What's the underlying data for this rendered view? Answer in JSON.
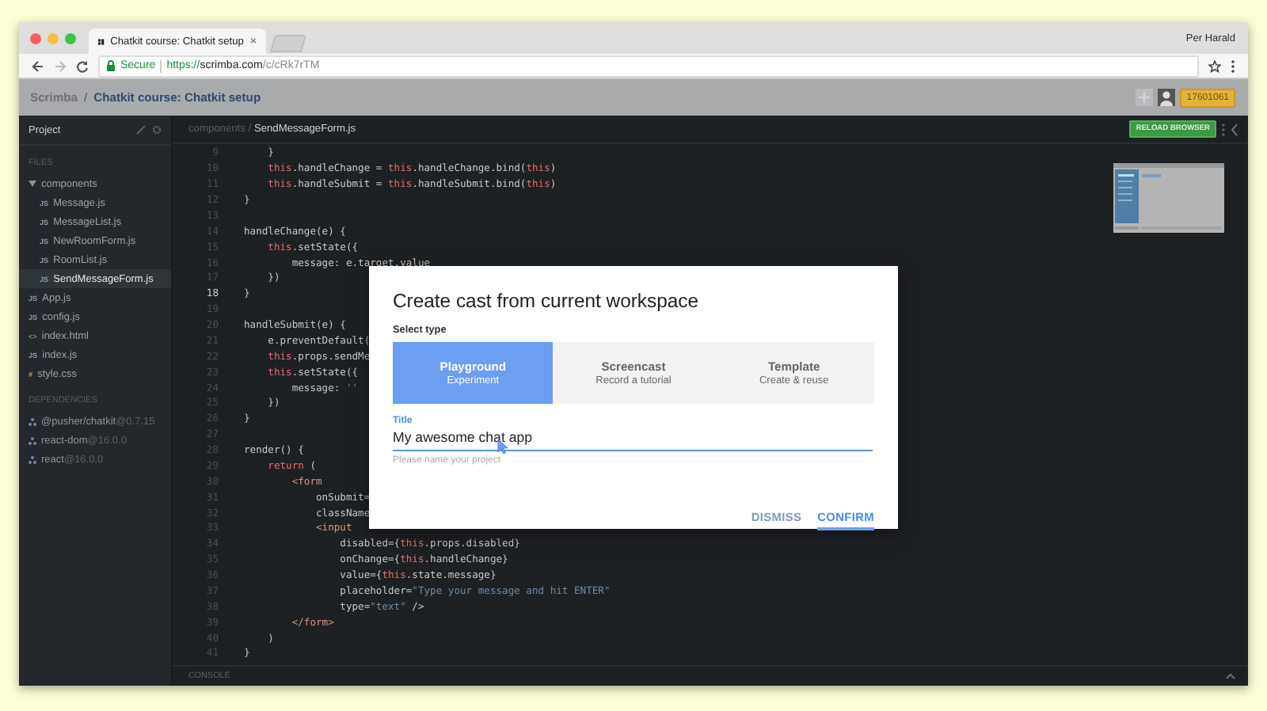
{
  "browser": {
    "tab": {
      "title": "Chatkit course: Chatkit setup",
      "close": "×"
    },
    "user": "Per Harald",
    "security": "Secure",
    "url": {
      "scheme": "https://",
      "host": "scrimba.com",
      "path": "/c/cRk7rTM"
    }
  },
  "header": {
    "brand": "Scrimba",
    "separator": "/",
    "course": "Chatkit course: Chatkit setup",
    "counter": "17601061"
  },
  "sidebar": {
    "title": "Project",
    "files_heading": "FILES",
    "files": [
      {
        "name": "components",
        "kind": "folder",
        "expanded": true,
        "selected": false,
        "children": [
          {
            "name": "Message.js",
            "kind": "js",
            "badge": "JS",
            "selected": false
          },
          {
            "name": "MessageList.js",
            "kind": "js",
            "badge": "JS",
            "selected": false
          },
          {
            "name": "NewRoomForm.js",
            "kind": "js",
            "badge": "JS",
            "selected": false
          },
          {
            "name": "RoomList.js",
            "kind": "js",
            "badge": "JS",
            "selected": false
          },
          {
            "name": "SendMessageForm.js",
            "kind": "js",
            "badge": "JS",
            "selected": true
          }
        ]
      },
      {
        "name": "App.js",
        "kind": "js",
        "badge": "JS",
        "selected": false
      },
      {
        "name": "config.js",
        "kind": "js",
        "badge": "JS",
        "selected": false
      },
      {
        "name": "index.html",
        "kind": "html",
        "badge": "<>",
        "selected": false
      },
      {
        "name": "index.js",
        "kind": "js",
        "badge": "JS",
        "selected": false
      },
      {
        "name": "style.css",
        "kind": "css",
        "badge": "#",
        "selected": false
      }
    ],
    "dependencies_heading": "DEPENDENCIES",
    "dependencies": [
      {
        "name": "@pusher/chatkit",
        "version": "@0.7.15"
      },
      {
        "name": "react-dom",
        "version": "@16.0.0"
      },
      {
        "name": "react",
        "version": "@16.0.0"
      }
    ]
  },
  "editor": {
    "path": {
      "folder": "components",
      "separator": "/",
      "file": "SendMessageForm.js"
    },
    "reload": "RELOAD BROWSER",
    "console": "CONSOLE",
    "lines": [
      {
        "number": "9",
        "current": false,
        "tokens": [
          {
            "text": "    }",
            "kind": "plain"
          }
        ]
      },
      {
        "number": "10",
        "current": false,
        "tokens": [
          {
            "text": "    this",
            "kind": "keyword"
          },
          {
            "text": ".handleChange = ",
            "kind": "plain"
          },
          {
            "text": "this",
            "kind": "keyword"
          },
          {
            "text": ".handleChange.bind(",
            "kind": "plain"
          },
          {
            "text": "this",
            "kind": "keyword"
          },
          {
            "text": ")",
            "kind": "plain"
          }
        ]
      },
      {
        "number": "11",
        "current": false,
        "tokens": [
          {
            "text": "    this",
            "kind": "keyword"
          },
          {
            "text": ".handleSubmit = ",
            "kind": "plain"
          },
          {
            "text": "this",
            "kind": "keyword"
          },
          {
            "text": ".handleSubmit.bind(",
            "kind": "plain"
          },
          {
            "text": "this",
            "kind": "keyword"
          },
          {
            "text": ")",
            "kind": "plain"
          }
        ]
      },
      {
        "number": "12",
        "current": false,
        "tokens": [
          {
            "text": "}",
            "kind": "plain"
          }
        ]
      },
      {
        "number": "13",
        "current": false
      },
      {
        "number": "14",
        "current": false,
        "tokens": [
          {
            "text": "handleChange(e) {",
            "kind": "plain"
          }
        ]
      },
      {
        "number": "15",
        "current": false,
        "tokens": [
          {
            "text": "    this",
            "kind": "keyword"
          },
          {
            "text": ".setState({",
            "kind": "plain"
          }
        ]
      },
      {
        "number": "16",
        "current": false,
        "tokens": [
          {
            "text": "        message: e.target.value",
            "kind": "plain"
          }
        ]
      },
      {
        "number": "17",
        "current": false,
        "tokens": [
          {
            "text": "    })",
            "kind": "plain"
          }
        ]
      },
      {
        "number": "18",
        "current": true,
        "tokens": [
          {
            "text": "}",
            "kind": "plain"
          }
        ]
      },
      {
        "number": "19",
        "current": false
      },
      {
        "number": "20",
        "current": false,
        "tokens": [
          {
            "text": "handleSubmit(e) {",
            "kind": "plain"
          }
        ]
      },
      {
        "number": "21",
        "current": false,
        "tokens": [
          {
            "text": "    e.preventDefault(",
            "kind": "plain"
          }
        ]
      },
      {
        "number": "22",
        "current": false,
        "tokens": [
          {
            "text": "    this",
            "kind": "keyword"
          },
          {
            "text": ".props.sendMe",
            "kind": "plain"
          }
        ]
      },
      {
        "number": "23",
        "current": false,
        "tokens": [
          {
            "text": "    this",
            "kind": "keyword"
          },
          {
            "text": ".setState({",
            "kind": "plain"
          }
        ]
      },
      {
        "number": "24",
        "current": false,
        "tokens": [
          {
            "text": "        message: ",
            "kind": "plain"
          },
          {
            "text": "''",
            "kind": "string"
          }
        ]
      },
      {
        "number": "25",
        "current": false,
        "tokens": [
          {
            "text": "    })",
            "kind": "plain"
          }
        ]
      },
      {
        "number": "26",
        "current": false,
        "tokens": [
          {
            "text": "}",
            "kind": "plain"
          }
        ]
      },
      {
        "number": "27",
        "current": false
      },
      {
        "number": "28",
        "current": false,
        "tokens": [
          {
            "text": "render() {",
            "kind": "plain"
          }
        ]
      },
      {
        "number": "29",
        "current": false,
        "tokens": [
          {
            "text": "    return",
            "kind": "keyword"
          },
          {
            "text": " (",
            "kind": "plain"
          }
        ]
      },
      {
        "number": "30",
        "current": false,
        "tokens": [
          {
            "text": "        <form",
            "kind": "tag"
          }
        ]
      },
      {
        "number": "31",
        "current": false,
        "tokens": [
          {
            "text": "            onSubmit=",
            "kind": "plain"
          }
        ]
      },
      {
        "number": "32",
        "current": false,
        "tokens": [
          {
            "text": "            className",
            "kind": "plain"
          }
        ]
      },
      {
        "number": "33",
        "current": false,
        "tokens": [
          {
            "text": "            <input",
            "kind": "tag"
          }
        ]
      },
      {
        "number": "34",
        "current": false,
        "tokens": [
          {
            "text": "                disabled={",
            "kind": "plain"
          },
          {
            "text": "this",
            "kind": "keyword"
          },
          {
            "text": ".props.disabled}",
            "kind": "plain"
          }
        ]
      },
      {
        "number": "35",
        "current": false,
        "tokens": [
          {
            "text": "                onChange={",
            "kind": "plain"
          },
          {
            "text": "this",
            "kind": "keyword"
          },
          {
            "text": ".handleChange}",
            "kind": "plain"
          }
        ]
      },
      {
        "number": "36",
        "current": false,
        "tokens": [
          {
            "text": "                value={",
            "kind": "plain"
          },
          {
            "text": "this",
            "kind": "keyword"
          },
          {
            "text": ".state.message}",
            "kind": "plain"
          }
        ]
      },
      {
        "number": "37",
        "current": false,
        "tokens": [
          {
            "text": "                placeholder=",
            "kind": "plain"
          },
          {
            "text": "\"Type your message and hit ENTER\"",
            "kind": "string"
          }
        ]
      },
      {
        "number": "38",
        "current": false,
        "tokens": [
          {
            "text": "                type=",
            "kind": "plain"
          },
          {
            "text": "\"text\"",
            "kind": "string"
          },
          {
            "text": " />",
            "kind": "plain"
          }
        ]
      },
      {
        "number": "39",
        "current": false,
        "tokens": [
          {
            "text": "        </form>",
            "kind": "tag"
          }
        ]
      },
      {
        "number": "40",
        "current": false,
        "tokens": [
          {
            "text": "    )",
            "kind": "plain"
          }
        ]
      },
      {
        "number": "41",
        "current": false,
        "tokens": [
          {
            "text": "}",
            "kind": "plain"
          }
        ]
      }
    ]
  },
  "modal": {
    "title": "Create cast from current workspace",
    "type_label": "Select type",
    "types": [
      {
        "name": "Playground",
        "description": "Experiment",
        "selected": true
      },
      {
        "name": "Screencast",
        "description": "Record a tutorial",
        "selected": false
      },
      {
        "name": "Template",
        "description": "Create & reuse",
        "selected": false
      }
    ],
    "field": {
      "label": "Title",
      "value": "My awesome chat app",
      "helper": "Please name your project"
    },
    "actions": [
      {
        "label": "DISMISS",
        "focused": false
      },
      {
        "label": "CONFIRM",
        "focused": true
      }
    ]
  }
}
